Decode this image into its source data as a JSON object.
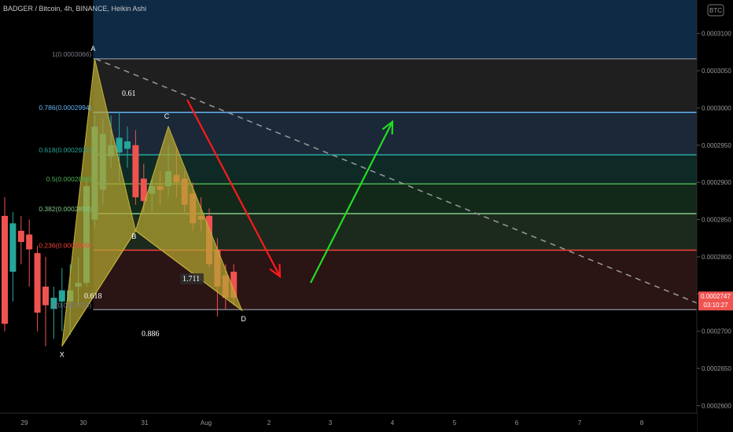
{
  "header": {
    "title": "BADGER / Bitcoin, 4h, BINANCE, Heikin Ashi",
    "currency_badge": "BTC"
  },
  "price_tag": {
    "price": "0.0002747",
    "countdown": "03:10:27",
    "color": "#ef5350"
  },
  "colors": {
    "bull": "#26a69a",
    "bear": "#ef5350",
    "pattern_fill": "#b5a632",
    "arrow_down": "#ff1a1a",
    "arrow_up": "#22dd22"
  },
  "chart_data": {
    "type": "candlestick",
    "title": "BADGER / Bitcoin, 4h, BINANCE, Heikin Ashi",
    "ylim": [
      0.000259,
      0.0003145
    ],
    "y_ticks": [
      "0.0003100",
      "0.0003050",
      "0.0003000",
      "0.0002950",
      "0.0002900",
      "0.0002850",
      "0.0002800",
      "0.0002750",
      "0.0002700",
      "0.0002650",
      "0.0002600"
    ],
    "x_ticks": [
      "29",
      "30",
      "31",
      "Aug",
      "2",
      "3",
      "4",
      "5",
      "6",
      "7",
      "8"
    ],
    "candles": [
      {
        "o": 0.0002855,
        "c": 0.000271,
        "h": 0.000288,
        "l": 0.00027
      },
      {
        "o": 0.000278,
        "c": 0.0002845,
        "h": 0.000286,
        "l": 0.000274
      },
      {
        "o": 0.0002835,
        "c": 0.000282,
        "h": 0.0002855,
        "l": 0.000279
      },
      {
        "o": 0.000283,
        "c": 0.000281,
        "h": 0.000285,
        "l": 0.000276
      },
      {
        "o": 0.0002805,
        "c": 0.0002725,
        "h": 0.0002815,
        "l": 0.00027
      },
      {
        "o": 0.000276,
        "c": 0.0002735,
        "h": 0.00028,
        "l": 0.000268
      },
      {
        "o": 0.000273,
        "c": 0.0002745,
        "h": 0.000276,
        "l": 0.000269
      },
      {
        "o": 0.000274,
        "c": 0.0002755,
        "h": 0.0002785,
        "l": 0.00027
      },
      {
        "o": 0.000274,
        "c": 0.0002755,
        "h": 0.000279,
        "l": 0.0002695
      },
      {
        "o": 0.000276,
        "c": 0.0002765,
        "h": 0.00028,
        "l": 0.0002735
      },
      {
        "o": 0.0002765,
        "c": 0.0002895,
        "h": 0.0002905,
        "l": 0.000276
      },
      {
        "o": 0.000285,
        "c": 0.0002975,
        "h": 0.000299,
        "l": 0.000284
      },
      {
        "o": 0.000289,
        "c": 0.0002965,
        "h": 0.0002985,
        "l": 0.000287
      },
      {
        "o": 0.0002935,
        "c": 0.000295,
        "h": 0.000299,
        "l": 0.000292
      },
      {
        "o": 0.000294,
        "c": 0.000296,
        "h": 0.0002995,
        "l": 0.00029
      },
      {
        "o": 0.0002945,
        "c": 0.0002955,
        "h": 0.0002975,
        "l": 0.000292
      },
      {
        "o": 0.000295,
        "c": 0.000288,
        "h": 0.000297,
        "l": 0.000287
      },
      {
        "o": 0.0002905,
        "c": 0.0002875,
        "h": 0.0002925,
        "l": 0.000286
      },
      {
        "o": 0.0002885,
        "c": 0.0002895,
        "h": 0.0002905,
        "l": 0.000286
      },
      {
        "o": 0.0002895,
        "c": 0.000289,
        "h": 0.0002915,
        "l": 0.000287
      },
      {
        "o": 0.0002895,
        "c": 0.0002915,
        "h": 0.000295,
        "l": 0.000288
      },
      {
        "o": 0.000291,
        "c": 0.00029,
        "h": 0.0002945,
        "l": 0.000288
      },
      {
        "o": 0.0002905,
        "c": 0.000287,
        "h": 0.0002915,
        "l": 0.000286
      },
      {
        "o": 0.0002885,
        "c": 0.0002845,
        "h": 0.00029,
        "l": 0.0002835
      },
      {
        "o": 0.0002855,
        "c": 0.000285,
        "h": 0.000288,
        "l": 0.0002835
      },
      {
        "o": 0.0002855,
        "c": 0.000279,
        "h": 0.0002865,
        "l": 0.0002785
      },
      {
        "o": 0.000281,
        "c": 0.000276,
        "h": 0.0002825,
        "l": 0.000272
      },
      {
        "o": 0.0002775,
        "c": 0.0002745,
        "h": 0.000279,
        "l": 0.000273
      },
      {
        "o": 0.000278,
        "c": 0.0002745,
        "h": 0.000279,
        "l": 0.0002735
      }
    ],
    "fib_levels": [
      {
        "ratio": 1,
        "label": "1(0.0003066)",
        "value": 0.0003066,
        "line": "#787b86",
        "band": "#1f1f1f"
      },
      {
        "ratio": 0.786,
        "label": "0.786(0.0002994)",
        "value": 0.0002994,
        "line": "#64b5f6",
        "band": "#1b2838"
      },
      {
        "ratio": 0.618,
        "label": "0.618(0.0002937)",
        "value": 0.0002937,
        "line": "#26a69a",
        "band": "#0f2a26"
      },
      {
        "ratio": 0.5,
        "label": "0.5(0.0002898)",
        "value": 0.0002898,
        "line": "#4caf50",
        "band": "#12291a"
      },
      {
        "ratio": 0.382,
        "label": "0.382(0.0002858)",
        "value": 0.0002858,
        "line": "#81c784",
        "band": "#1c2a1e"
      },
      {
        "ratio": 0.236,
        "label": "0.236(0.0002809)",
        "value": 0.0002809,
        "line": "#f44336",
        "band": "#2a1414"
      },
      {
        "ratio": 0,
        "label": "0(0.0002729)",
        "value": 0.0002729,
        "line": "#787b86",
        "band": "#3a1010"
      }
    ],
    "upper_zone_color": "#0e2a45",
    "pattern": {
      "points": {
        "X": {
          "bar": 7,
          "value": 0.000268
        },
        "A": {
          "bar": 11,
          "value": 0.0003066
        },
        "B": {
          "bar": 16,
          "value": 0.0002835
        },
        "C": {
          "bar": 20,
          "value": 0.0002975
        },
        "D": {
          "bar": 29,
          "value": 0.0002728
        }
      },
      "ratios": [
        "0.61",
        "1.711",
        "0.618",
        "0.886"
      ]
    }
  }
}
